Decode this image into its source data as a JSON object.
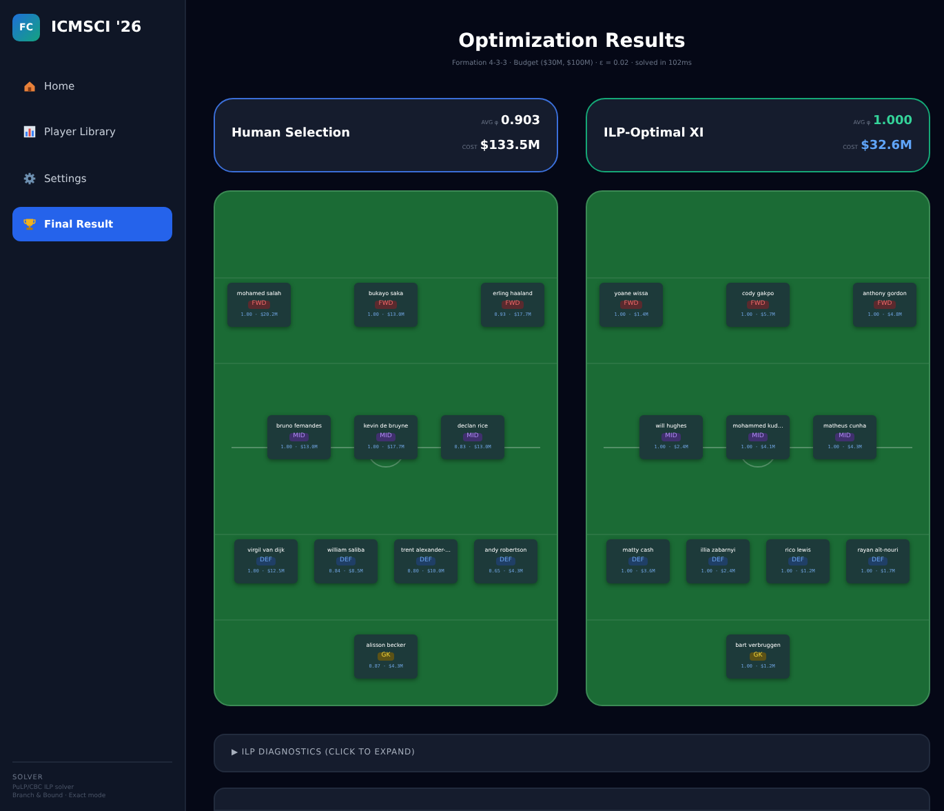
{
  "brand": {
    "logo": "FC",
    "name": "ICMSCI '26"
  },
  "nav": [
    {
      "label": "Home",
      "selected": false
    },
    {
      "label": "Player Library",
      "selected": false
    },
    {
      "label": "Settings",
      "selected": false
    },
    {
      "label": "Final Result",
      "selected": true
    }
  ],
  "solver": {
    "heading": "SOLVER",
    "lines": [
      "PuLP/CBC ILP solver",
      "Branch & Bound · Exact mode"
    ]
  },
  "title": "Optimization Results",
  "subtitle": "Formation 4-3-3 · Budget ($30M, $100M) · ε = 0.02 · solved in 102ms",
  "teams": [
    {
      "kind": "human",
      "name": "Human Selection",
      "avg_label": "AVG φ",
      "avg": "0.903",
      "cost_label": "COST",
      "cost": "$133.5M",
      "lines": [
        [
          {
            "name": "mohamed salah",
            "pos": "FWD",
            "stats": "1.00 · $20.2M"
          },
          {
            "name": "bukayo saka",
            "pos": "FWD",
            "stats": "1.00 · $13.0M"
          },
          {
            "name": "erling haaland",
            "pos": "FWD",
            "stats": "0.93 · $17.7M"
          }
        ],
        [
          {
            "name": "bruno fernandes",
            "pos": "MID",
            "stats": "1.00 · $13.0M"
          },
          {
            "name": "kevin de bruyne",
            "pos": "MID",
            "stats": "1.00 · $17.7M"
          },
          {
            "name": "declan rice",
            "pos": "MID",
            "stats": "0.83 · $13.0M"
          }
        ],
        [
          {
            "name": "virgil van dijk",
            "pos": "DEF",
            "stats": "1.00 · $12.5M"
          },
          {
            "name": "william saliba",
            "pos": "DEF",
            "stats": "0.84 · $8.5M"
          },
          {
            "name": "trent alexander-…",
            "pos": "DEF",
            "stats": "0.80 · $10.0M"
          },
          {
            "name": "andy robertson",
            "pos": "DEF",
            "stats": "0.65 · $4.3M"
          }
        ],
        [
          {
            "name": "alisson becker",
            "pos": "GK",
            "stats": "0.87 · $4.3M"
          }
        ]
      ]
    },
    {
      "kind": "optimal",
      "name": "ILP-Optimal XI",
      "avg_label": "AVG φ",
      "avg": "1.000",
      "cost_label": "COST",
      "cost": "$32.6M",
      "lines": [
        [
          {
            "name": "yoane wissa",
            "pos": "FWD",
            "stats": "1.00 · $1.4M"
          },
          {
            "name": "cody gakpo",
            "pos": "FWD",
            "stats": "1.00 · $5.7M"
          },
          {
            "name": "anthony gordon",
            "pos": "FWD",
            "stats": "1.00 · $4.8M"
          }
        ],
        [
          {
            "name": "will hughes",
            "pos": "MID",
            "stats": "1.00 · $2.4M"
          },
          {
            "name": "mohammed kud…",
            "pos": "MID",
            "stats": "1.00 · $4.1M"
          },
          {
            "name": "matheus cunha",
            "pos": "MID",
            "stats": "1.00 · $4.3M"
          }
        ],
        [
          {
            "name": "matty cash",
            "pos": "DEF",
            "stats": "1.00 · $3.6M"
          },
          {
            "name": "illia zabarnyi",
            "pos": "DEF",
            "stats": "1.00 · $2.4M"
          },
          {
            "name": "rico lewis",
            "pos": "DEF",
            "stats": "1.00 · $1.2M"
          },
          {
            "name": "rayan aït-nouri",
            "pos": "DEF",
            "stats": "1.00 · $1.7M"
          }
        ],
        [
          {
            "name": "bart verbruggen",
            "pos": "GK",
            "stats": "1.00 · $1.2M"
          }
        ]
      ]
    }
  ],
  "diagnostics": {
    "label": "▶ ILP DIAGNOSTICS (CLICK TO EXPAND)",
    "expanded": false
  }
}
